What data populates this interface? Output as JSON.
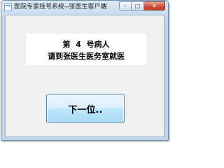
{
  "window": {
    "title": "医院专家挂号系统--张医生客户端"
  },
  "caption": {
    "minimize": "–",
    "maximize": "□",
    "close": "✕"
  },
  "patient": {
    "line1": "第  4  号病人",
    "line2": "请到张医生医务室就医"
  },
  "actions": {
    "next_label": "下一位.."
  }
}
